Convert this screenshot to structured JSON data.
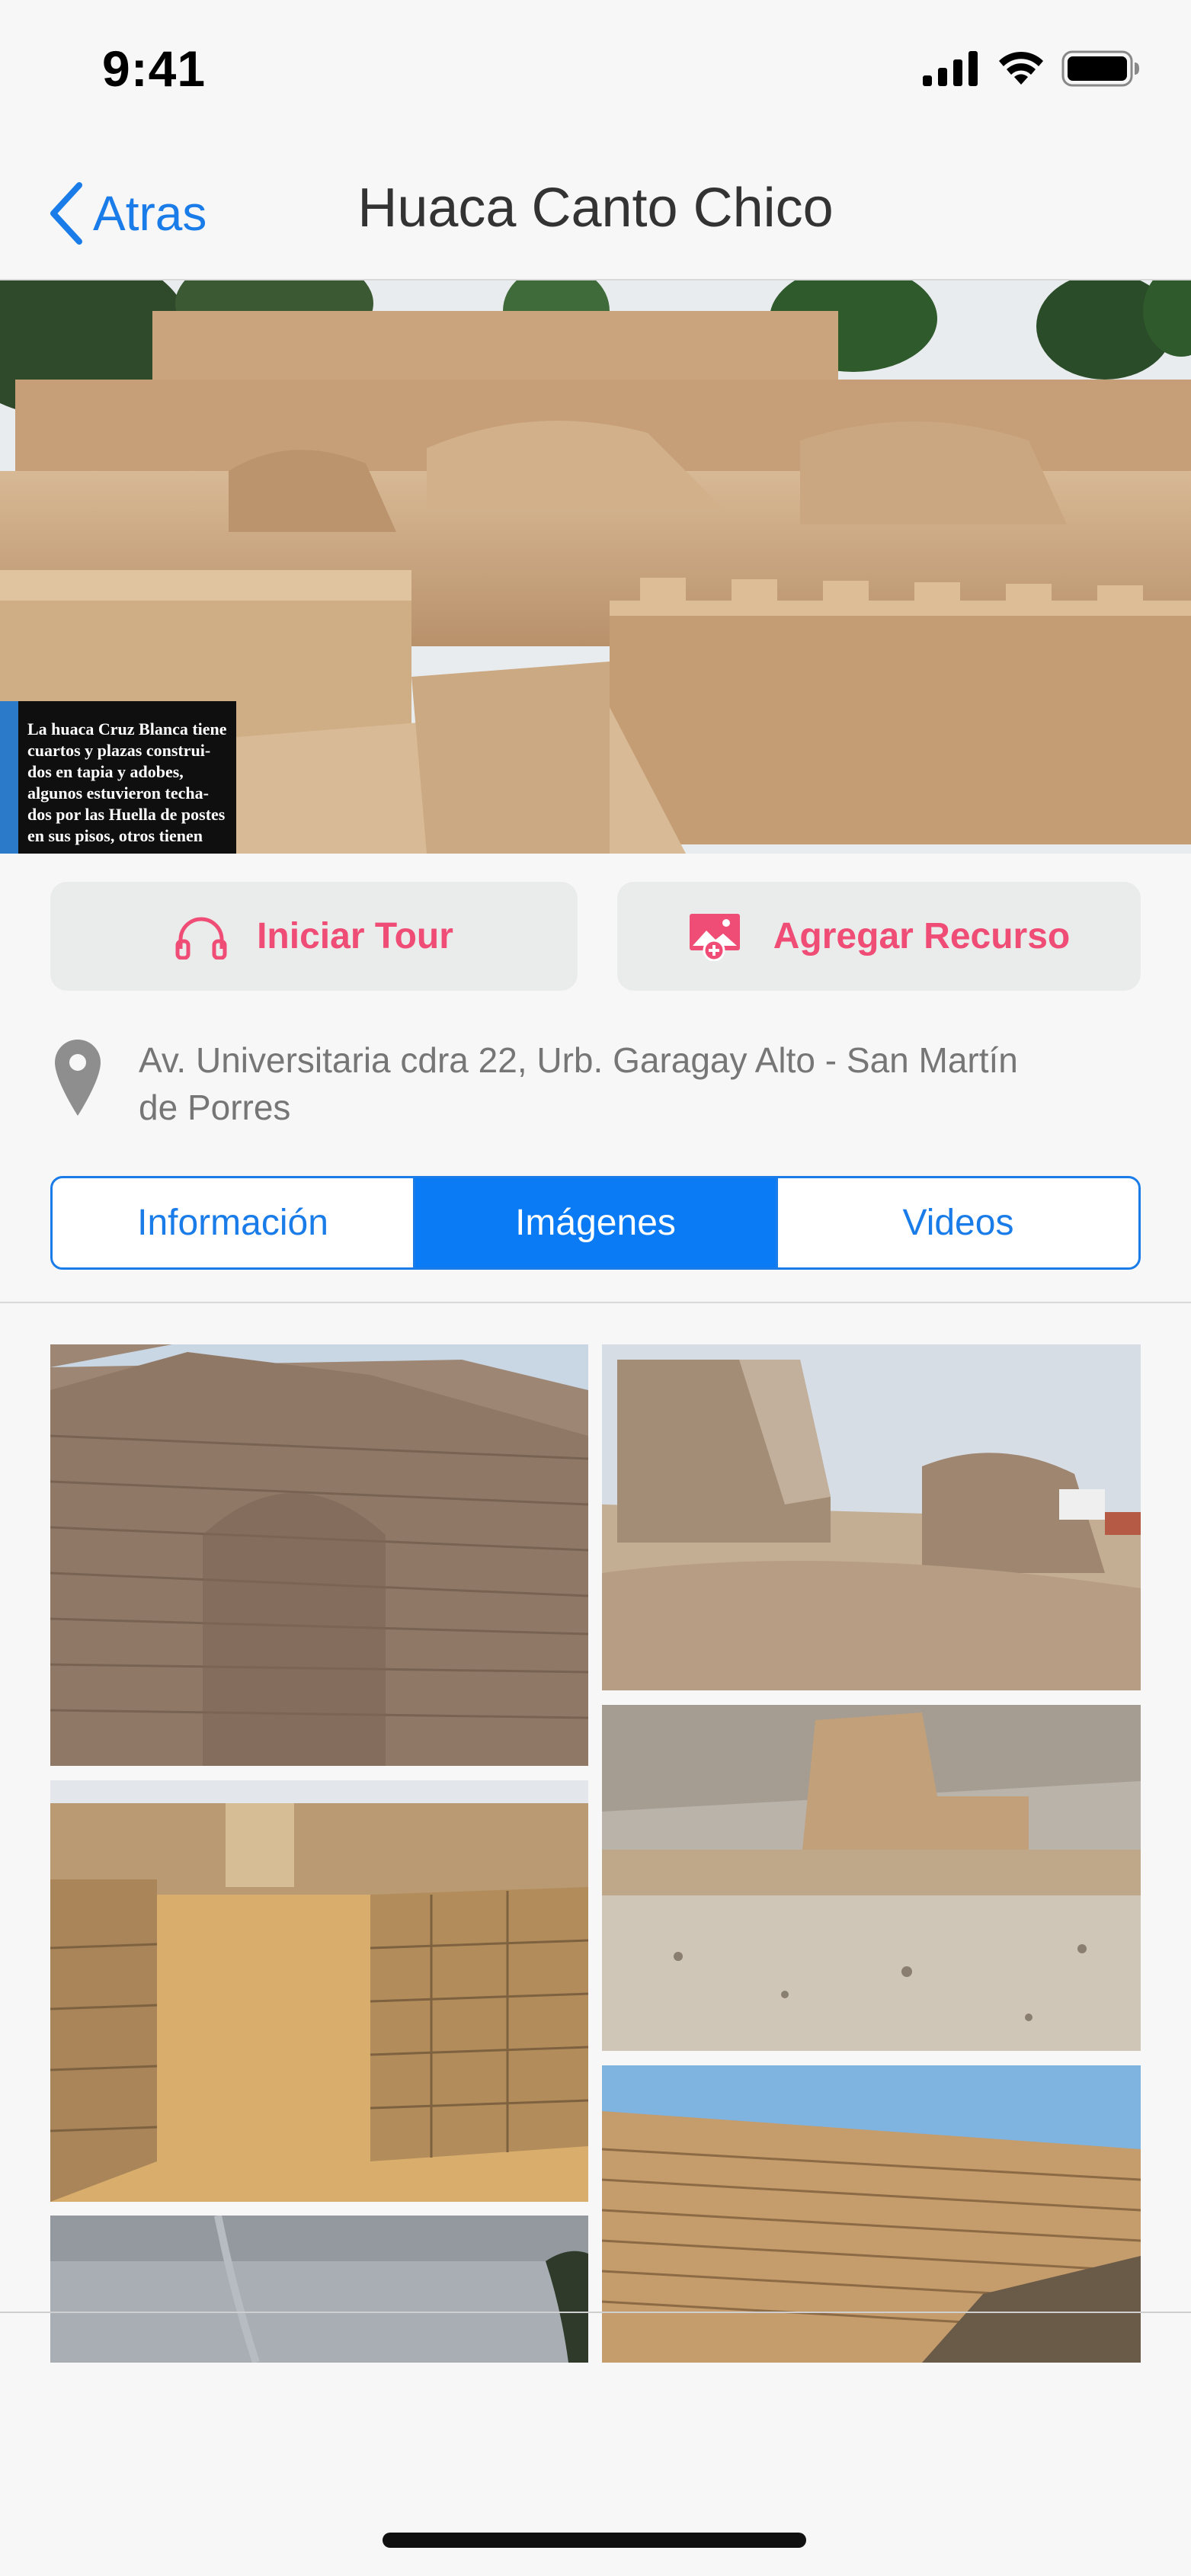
{
  "status_bar": {
    "time": "9:41",
    "icons": [
      "signal-icon",
      "wifi-icon",
      "battery-icon"
    ]
  },
  "nav": {
    "back_label": "Atras",
    "title": "Huaca Canto Chico"
  },
  "hero": {
    "sign_text": "La huaca Cruz Blanca tiene cuartos y plazas construi- dos en tapia y adobes, algunos estuvieron techa- dos por las Huella de postes en sus pisos, otros tienen restos de pintura blanca en muros hace a la"
  },
  "actions": {
    "tour_label": "Iniciar Tour",
    "add_label": "Agregar Recurso"
  },
  "address": {
    "line1": "Av. Universitaria cdra 22, Urb. Garagay Alto - San Martín",
    "line2": "de Porres"
  },
  "tabs": [
    {
      "label": "Información",
      "active": false
    },
    {
      "label": "Imágenes",
      "active": true
    },
    {
      "label": "Videos",
      "active": false
    }
  ],
  "colors": {
    "accent_blue": "#0a7af5",
    "action_pink": "#ef4d75",
    "address_gray": "#767676"
  },
  "gallery": {
    "items": [
      "image-1",
      "image-2",
      "image-3",
      "image-4",
      "image-5",
      "image-6"
    ]
  }
}
